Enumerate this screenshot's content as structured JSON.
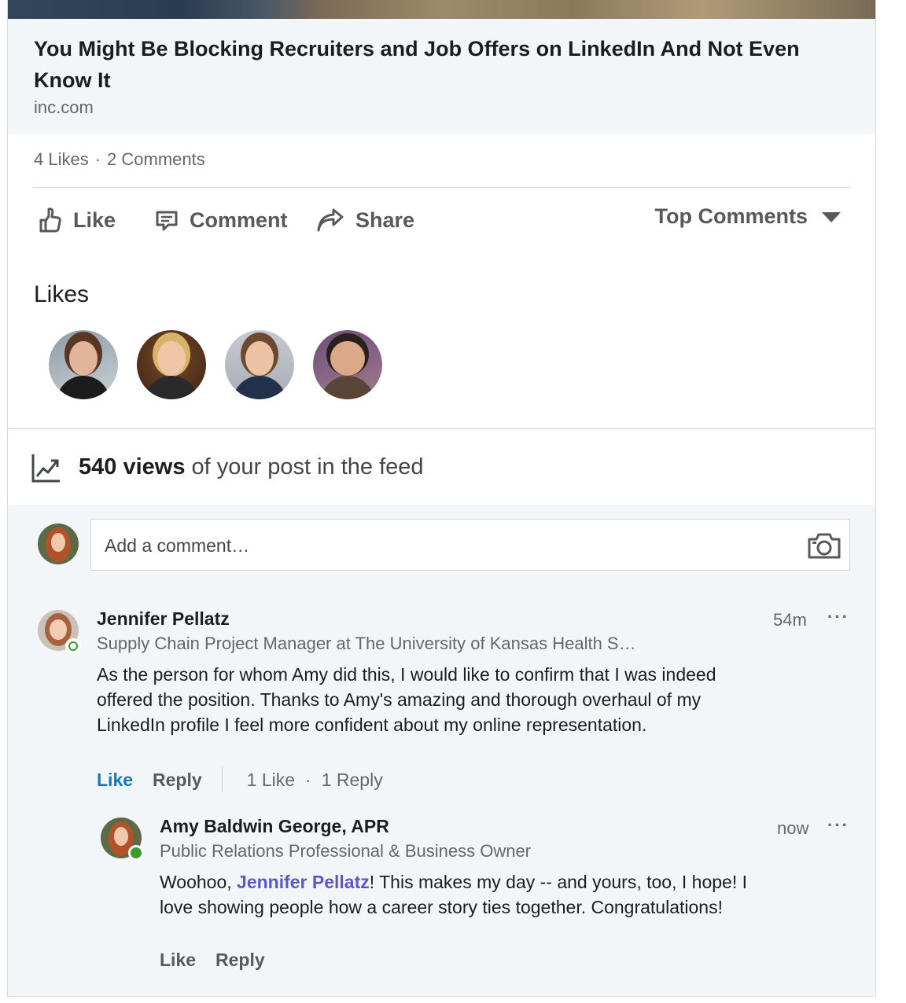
{
  "article": {
    "title": "You Might Be Blocking Recruiters and Job Offers on LinkedIn And Not Even Know It",
    "source": "inc.com"
  },
  "social": {
    "likes_count": "4 Likes",
    "comments_count": "2 Comments"
  },
  "actions": {
    "like": "Like",
    "comment": "Comment",
    "share": "Share",
    "sort": "Top Comments"
  },
  "likes_section": {
    "heading": "Likes"
  },
  "views": {
    "count": "540 views",
    "suffix": " of your post in the feed"
  },
  "comment_box": {
    "placeholder": "Add a comment…"
  },
  "comments": [
    {
      "author": "Jennifer Pellatz",
      "headline": "Supply Chain Project Manager at The University of Kansas Health S…",
      "time": "54m",
      "text": "As the person for whom Amy did this, I would like to confirm that I was indeed offered the position. Thanks to Amy's amazing and thorough overhaul of my LinkedIn profile I feel more confident about my online representation.",
      "like_label": "Like",
      "reply_label": "Reply",
      "like_count": "1 Like",
      "reply_count": "1 Reply"
    }
  ],
  "reply": {
    "author": "Amy Baldwin George, APR",
    "headline": "Public Relations Professional & Business Owner",
    "time": "now",
    "text_before": "Woohoo, ",
    "mention": "Jennifer Pellatz",
    "text_after": "! This makes my day -- and yours, too, I hope! I love showing people how a career story ties together. Congratulations!",
    "like_label": "Like",
    "reply_label": "Reply"
  },
  "more_label": "···",
  "colors": {
    "link_blue": "#0e7cc0",
    "mention_purple": "#5a58c8",
    "presence_green": "#3a9c2f",
    "panel_gray": "#f3f6f8"
  }
}
